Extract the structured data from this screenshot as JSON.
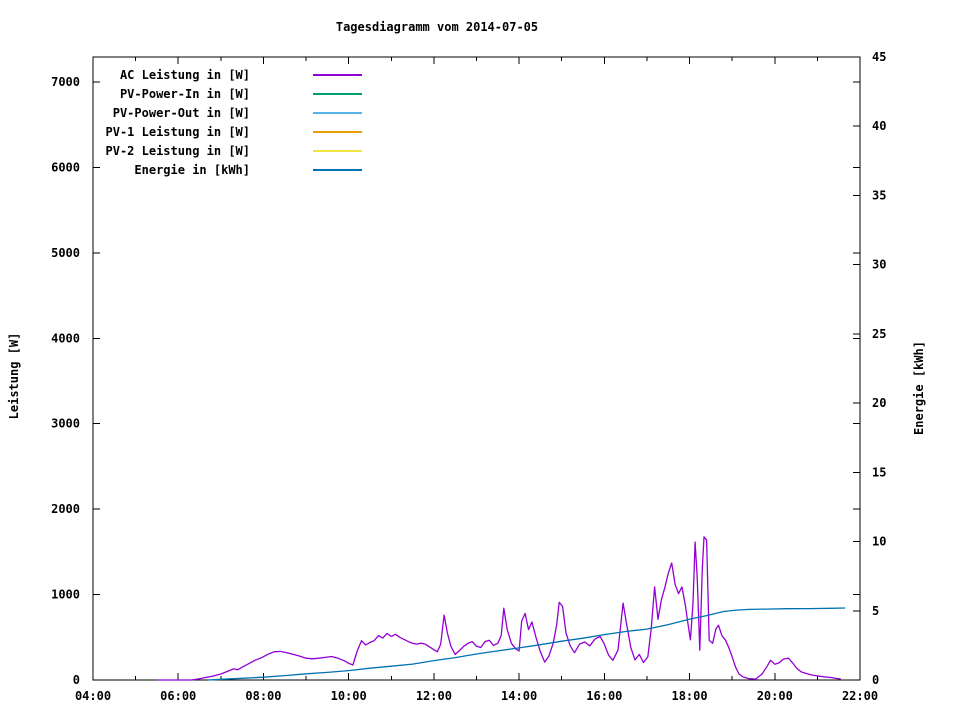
{
  "title": "Tagesdiagramm vom 2014-07-05",
  "y_axis_label": "Leistung [W]",
  "y2_axis_label": "Energie [kWh]",
  "chart_data": {
    "type": "line",
    "title": "Tagesdiagramm vom 2014-07-05",
    "xlabel": "",
    "ylabel": "Leistung [W]",
    "y2label": "Energie [kWh]",
    "grid": false,
    "legend_position": "top-left",
    "xlim": [
      4,
      22
    ],
    "ylim": [
      0,
      7292
    ],
    "y2lim": [
      0,
      45
    ],
    "x_major_ticks": [
      4,
      6,
      8,
      10,
      12,
      14,
      16,
      18,
      20,
      22
    ],
    "x_major_tick_labels": [
      "04:00",
      "06:00",
      "08:00",
      "10:00",
      "12:00",
      "14:00",
      "16:00",
      "18:00",
      "20:00",
      "22:00"
    ],
    "x_minor_ticks": [
      5,
      7,
      9,
      11,
      13,
      15,
      17,
      19,
      21
    ],
    "y_ticks": [
      0,
      1000,
      2000,
      3000,
      4000,
      5000,
      6000,
      7000
    ],
    "y_tick_labels": [
      "0",
      "1000",
      "2000",
      "3000",
      "4000",
      "5000",
      "6000",
      "7000"
    ],
    "y2_ticks": [
      0,
      5,
      10,
      15,
      20,
      25,
      30,
      35,
      40,
      45
    ],
    "y2_tick_labels": [
      "0",
      "5",
      "10",
      "15",
      "20",
      "25",
      "30",
      "35",
      "40",
      "45"
    ],
    "series": [
      {
        "name": "AC Leistung in [W]",
        "color": "#9400d3",
        "axis": "left",
        "points": [
          [
            5.5,
            0
          ],
          [
            6.0,
            0
          ],
          [
            6.3,
            0
          ],
          [
            6.45,
            10
          ],
          [
            6.6,
            25
          ],
          [
            6.8,
            45
          ],
          [
            7.0,
            70
          ],
          [
            7.15,
            100
          ],
          [
            7.3,
            130
          ],
          [
            7.4,
            120
          ],
          [
            7.5,
            150
          ],
          [
            7.65,
            190
          ],
          [
            7.8,
            230
          ],
          [
            7.95,
            260
          ],
          [
            8.1,
            300
          ],
          [
            8.25,
            330
          ],
          [
            8.4,
            335
          ],
          [
            8.55,
            320
          ],
          [
            8.7,
            300
          ],
          [
            8.85,
            280
          ],
          [
            9.0,
            255
          ],
          [
            9.15,
            248
          ],
          [
            9.3,
            255
          ],
          [
            9.45,
            265
          ],
          [
            9.6,
            275
          ],
          [
            9.75,
            255
          ],
          [
            9.9,
            225
          ],
          [
            10.0,
            195
          ],
          [
            10.1,
            175
          ],
          [
            10.2,
            340
          ],
          [
            10.3,
            460
          ],
          [
            10.4,
            410
          ],
          [
            10.5,
            440
          ],
          [
            10.6,
            460
          ],
          [
            10.7,
            520
          ],
          [
            10.8,
            490
          ],
          [
            10.9,
            545
          ],
          [
            11.0,
            510
          ],
          [
            11.1,
            535
          ],
          [
            11.2,
            500
          ],
          [
            11.3,
            475
          ],
          [
            11.4,
            450
          ],
          [
            11.5,
            430
          ],
          [
            11.6,
            420
          ],
          [
            11.7,
            432
          ],
          [
            11.8,
            418
          ],
          [
            11.9,
            388
          ],
          [
            12.0,
            355
          ],
          [
            12.08,
            330
          ],
          [
            12.16,
            420
          ],
          [
            12.24,
            760
          ],
          [
            12.32,
            545
          ],
          [
            12.4,
            395
          ],
          [
            12.5,
            300
          ],
          [
            12.6,
            345
          ],
          [
            12.7,
            395
          ],
          [
            12.8,
            430
          ],
          [
            12.9,
            450
          ],
          [
            13.0,
            395
          ],
          [
            13.1,
            380
          ],
          [
            13.2,
            450
          ],
          [
            13.3,
            465
          ],
          [
            13.4,
            405
          ],
          [
            13.5,
            430
          ],
          [
            13.58,
            520
          ],
          [
            13.64,
            840
          ],
          [
            13.72,
            590
          ],
          [
            13.82,
            430
          ],
          [
            13.92,
            365
          ],
          [
            14.0,
            340
          ],
          [
            14.06,
            690
          ],
          [
            14.14,
            780
          ],
          [
            14.22,
            590
          ],
          [
            14.3,
            680
          ],
          [
            14.4,
            490
          ],
          [
            14.5,
            330
          ],
          [
            14.6,
            210
          ],
          [
            14.7,
            280
          ],
          [
            14.8,
            430
          ],
          [
            14.88,
            640
          ],
          [
            14.94,
            910
          ],
          [
            15.02,
            860
          ],
          [
            15.1,
            550
          ],
          [
            15.2,
            400
          ],
          [
            15.3,
            320
          ],
          [
            15.42,
            420
          ],
          [
            15.54,
            445
          ],
          [
            15.66,
            400
          ],
          [
            15.78,
            480
          ],
          [
            15.9,
            510
          ],
          [
            16.0,
            420
          ],
          [
            16.1,
            290
          ],
          [
            16.2,
            230
          ],
          [
            16.32,
            350
          ],
          [
            16.44,
            900
          ],
          [
            16.52,
            660
          ],
          [
            16.62,
            380
          ],
          [
            16.72,
            235
          ],
          [
            16.82,
            300
          ],
          [
            16.92,
            205
          ],
          [
            17.02,
            270
          ],
          [
            17.1,
            600
          ],
          [
            17.18,
            1090
          ],
          [
            17.26,
            710
          ],
          [
            17.34,
            940
          ],
          [
            17.42,
            1080
          ],
          [
            17.5,
            1250
          ],
          [
            17.58,
            1370
          ],
          [
            17.66,
            1120
          ],
          [
            17.74,
            1010
          ],
          [
            17.82,
            1090
          ],
          [
            17.9,
            880
          ],
          [
            17.96,
            665
          ],
          [
            18.02,
            470
          ],
          [
            18.08,
            900
          ],
          [
            18.13,
            1615
          ],
          [
            18.18,
            1200
          ],
          [
            18.24,
            350
          ],
          [
            18.3,
            1300
          ],
          [
            18.34,
            1675
          ],
          [
            18.4,
            1640
          ],
          [
            18.46,
            465
          ],
          [
            18.54,
            430
          ],
          [
            18.62,
            600
          ],
          [
            18.68,
            640
          ],
          [
            18.76,
            520
          ],
          [
            18.84,
            470
          ],
          [
            18.92,
            380
          ],
          [
            19.0,
            270
          ],
          [
            19.08,
            150
          ],
          [
            19.16,
            70
          ],
          [
            19.26,
            35
          ],
          [
            19.4,
            15
          ],
          [
            19.55,
            10
          ],
          [
            19.7,
            70
          ],
          [
            19.82,
            160
          ],
          [
            19.9,
            230
          ],
          [
            20.0,
            185
          ],
          [
            20.1,
            200
          ],
          [
            20.2,
            245
          ],
          [
            20.32,
            255
          ],
          [
            20.42,
            200
          ],
          [
            20.52,
            135
          ],
          [
            20.62,
            95
          ],
          [
            20.72,
            80
          ],
          [
            20.85,
            60
          ],
          [
            21.0,
            48
          ],
          [
            21.15,
            38
          ],
          [
            21.3,
            30
          ],
          [
            21.45,
            18
          ],
          [
            21.55,
            12
          ]
        ]
      },
      {
        "name": "PV-Power-In in [W]",
        "color": "#009e73",
        "axis": "left",
        "points": []
      },
      {
        "name": "PV-Power-Out in [W]",
        "color": "#56b4e9",
        "axis": "left",
        "points": []
      },
      {
        "name": "PV-1 Leistung in [W]",
        "color": "#e69f00",
        "axis": "left",
        "points": []
      },
      {
        "name": "PV-2 Leistung in [W]",
        "color": "#f0e442",
        "axis": "left",
        "points": []
      },
      {
        "name": "Energie in [kWh]",
        "color": "#0072b2",
        "axis": "right",
        "points": [
          [
            6.7,
            0
          ],
          [
            7.0,
            0.05
          ],
          [
            7.5,
            0.12
          ],
          [
            8.0,
            0.2
          ],
          [
            8.5,
            0.32
          ],
          [
            9.0,
            0.45
          ],
          [
            9.5,
            0.55
          ],
          [
            10.0,
            0.68
          ],
          [
            10.5,
            0.85
          ],
          [
            11.0,
            1.0
          ],
          [
            11.5,
            1.15
          ],
          [
            12.0,
            1.4
          ],
          [
            12.5,
            1.62
          ],
          [
            13.0,
            1.88
          ],
          [
            13.5,
            2.1
          ],
          [
            14.0,
            2.32
          ],
          [
            14.5,
            2.55
          ],
          [
            15.0,
            2.8
          ],
          [
            15.5,
            3.02
          ],
          [
            16.0,
            3.28
          ],
          [
            16.5,
            3.5
          ],
          [
            17.0,
            3.68
          ],
          [
            17.5,
            4.0
          ],
          [
            18.0,
            4.4
          ],
          [
            18.4,
            4.65
          ],
          [
            18.8,
            4.95
          ],
          [
            19.1,
            5.05
          ],
          [
            19.4,
            5.1
          ],
          [
            19.8,
            5.12
          ],
          [
            20.3,
            5.15
          ],
          [
            20.8,
            5.16
          ],
          [
            21.3,
            5.18
          ],
          [
            21.65,
            5.2
          ]
        ]
      }
    ]
  }
}
